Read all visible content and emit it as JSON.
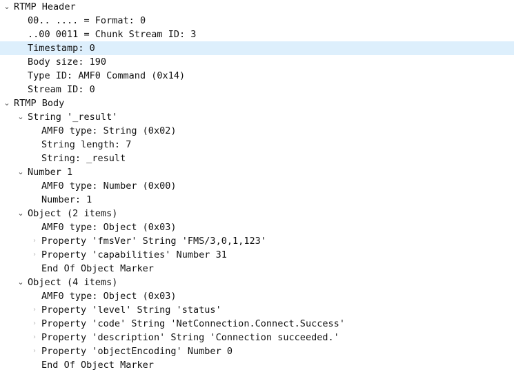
{
  "window": {
    "title": "RTMP Packet Detail Tree",
    "background_color": "#ffffff",
    "text_color": "#111111",
    "selection_color": "#ddeffc",
    "open_twisty_color": "#4a4a4a",
    "closed_twisty_color": "#b9b9b9"
  },
  "icons": {
    "chevron_down": "⌄",
    "chevron_right": "›"
  },
  "tree": {
    "rows": [
      {
        "indent": 0,
        "twisty": "open",
        "selected": false,
        "text": "RTMP Header"
      },
      {
        "indent": 1,
        "twisty": "none",
        "selected": false,
        "text": "00.. .... = Format: 0"
      },
      {
        "indent": 1,
        "twisty": "none",
        "selected": false,
        "text": "..00 0011 = Chunk Stream ID: 3"
      },
      {
        "indent": 1,
        "twisty": "none",
        "selected": true,
        "text": "Timestamp: 0"
      },
      {
        "indent": 1,
        "twisty": "none",
        "selected": false,
        "text": "Body size: 190"
      },
      {
        "indent": 1,
        "twisty": "none",
        "selected": false,
        "text": "Type ID: AMF0 Command (0x14)"
      },
      {
        "indent": 1,
        "twisty": "none",
        "selected": false,
        "text": "Stream ID: 0"
      },
      {
        "indent": 0,
        "twisty": "open",
        "selected": false,
        "text": "RTMP Body"
      },
      {
        "indent": 1,
        "twisty": "open",
        "selected": false,
        "text": "String '_result'"
      },
      {
        "indent": 2,
        "twisty": "none",
        "selected": false,
        "text": "AMF0 type: String (0x02)"
      },
      {
        "indent": 2,
        "twisty": "none",
        "selected": false,
        "text": "String length: 7"
      },
      {
        "indent": 2,
        "twisty": "none",
        "selected": false,
        "text": "String: _result"
      },
      {
        "indent": 1,
        "twisty": "open",
        "selected": false,
        "text": "Number 1"
      },
      {
        "indent": 2,
        "twisty": "none",
        "selected": false,
        "text": "AMF0 type: Number (0x00)"
      },
      {
        "indent": 2,
        "twisty": "none",
        "selected": false,
        "text": "Number: 1"
      },
      {
        "indent": 1,
        "twisty": "open",
        "selected": false,
        "text": "Object (2 items)"
      },
      {
        "indent": 2,
        "twisty": "none",
        "selected": false,
        "text": "AMF0 type: Object (0x03)"
      },
      {
        "indent": 2,
        "twisty": "closed",
        "selected": false,
        "text": "Property 'fmsVer' String 'FMS/3,0,1,123'"
      },
      {
        "indent": 2,
        "twisty": "closed",
        "selected": false,
        "text": "Property 'capabilities' Number 31"
      },
      {
        "indent": 2,
        "twisty": "none",
        "selected": false,
        "text": "End Of Object Marker"
      },
      {
        "indent": 1,
        "twisty": "open",
        "selected": false,
        "text": "Object (4 items)"
      },
      {
        "indent": 2,
        "twisty": "none",
        "selected": false,
        "text": "AMF0 type: Object (0x03)"
      },
      {
        "indent": 2,
        "twisty": "closed",
        "selected": false,
        "text": "Property 'level' String 'status'"
      },
      {
        "indent": 2,
        "twisty": "closed",
        "selected": false,
        "text": "Property 'code' String 'NetConnection.Connect.Success'"
      },
      {
        "indent": 2,
        "twisty": "closed",
        "selected": false,
        "text": "Property 'description' String 'Connection succeeded.'"
      },
      {
        "indent": 2,
        "twisty": "closed",
        "selected": false,
        "text": "Property 'objectEncoding' Number 0"
      },
      {
        "indent": 2,
        "twisty": "none",
        "selected": false,
        "text": "End Of Object Marker"
      }
    ]
  }
}
